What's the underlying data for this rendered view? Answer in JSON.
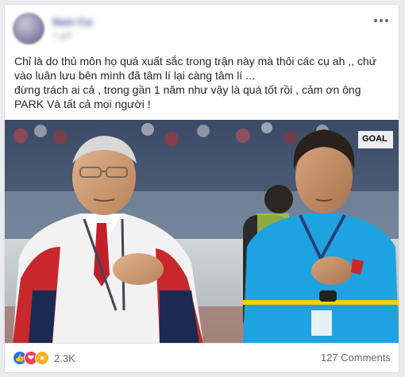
{
  "post": {
    "author_name": "Nam Cự",
    "timestamp": "1 giờ",
    "text_lines": [
      "Chỉ là do thủ môn họ quá xuất sắc trong trận này mà thôi các cụ ah ,, chứ",
      "vào luân lưu bên mình đã tâm lí lại càng tâm lí ...",
      "đừng trách ai cả , trong gần 1 năm như vậy là quá tốt rồi , cảm ơn ông",
      "PARK Và tất cả mọi người !"
    ]
  },
  "photo": {
    "watermark": "GOAL"
  },
  "footer": {
    "reaction_icons": [
      "like-icon",
      "love-icon",
      "sad-icon"
    ],
    "reaction_count": "2.3K",
    "comments_label": "127 Comments"
  }
}
